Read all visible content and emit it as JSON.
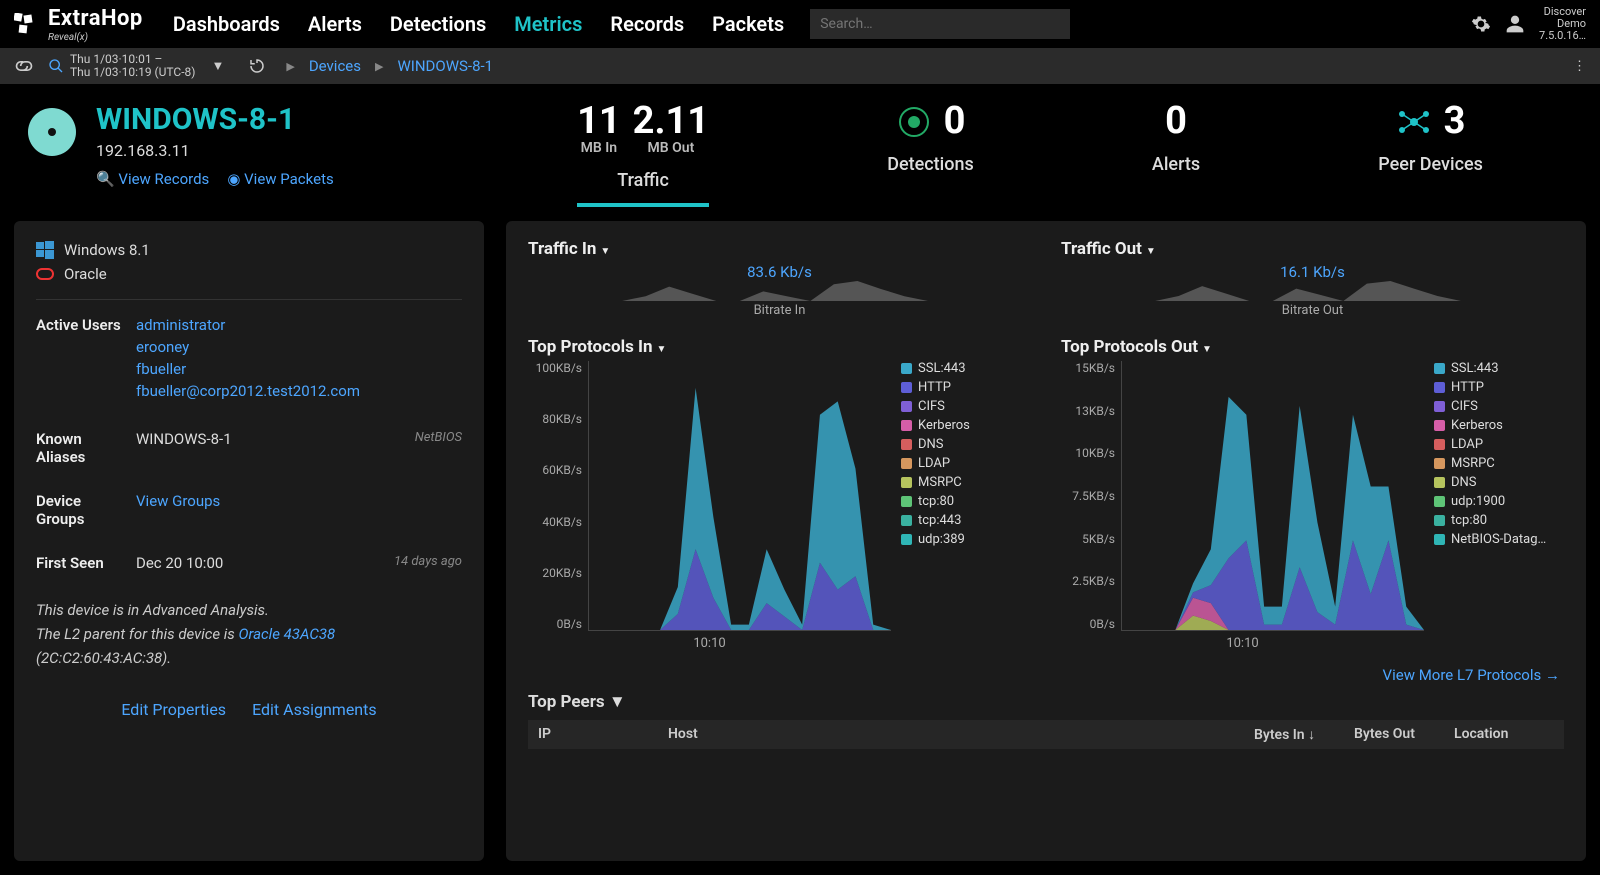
{
  "brand": {
    "name": "ExtraHop",
    "sub": "Reveal(x)"
  },
  "nav": {
    "items": [
      "Dashboards",
      "Alerts",
      "Detections",
      "Metrics",
      "Records",
      "Packets"
    ],
    "active_index": 3,
    "search_placeholder": "Search…"
  },
  "nav_right": {
    "line1": "Discover",
    "line2": "Demo",
    "line3": "7.5.0.16…"
  },
  "subbar": {
    "range_line1": "Thu 1/03·10:01 –",
    "range_line2": "Thu 1/03·10:19 (UTC-8)",
    "crumb1": "Devices",
    "crumb2": "WINDOWS-8-1"
  },
  "device": {
    "name": "WINDOWS-8-1",
    "ip": "192.168.3.11",
    "view_records": "View Records",
    "view_packets": "View Packets"
  },
  "stats": {
    "traffic": {
      "in_val": "11",
      "in_unit": "MB In",
      "out_val": "2.11",
      "out_unit": "MB Out",
      "label": "Traffic"
    },
    "detections": {
      "val": "0",
      "label": "Detections"
    },
    "alerts": {
      "val": "0",
      "label": "Alerts"
    },
    "peers": {
      "val": "3",
      "label": "Peer Devices"
    }
  },
  "sidebar": {
    "os1": "Windows 8.1",
    "os2": "Oracle",
    "active_users_label": "Active Users",
    "active_users": [
      "administrator",
      "erooney",
      "fbueller",
      "fbueller@corp2012.test2012.com"
    ],
    "aliases_label": "Known Aliases",
    "alias_val": "WINDOWS-8-1",
    "alias_type": "NetBIOS",
    "groups_label": "Device Groups",
    "groups_link": "View Groups",
    "first_seen_label": "First Seen",
    "first_seen_val": "Dec 20 10:00",
    "first_seen_ago": "14 days ago",
    "note1": "This device is in Advanced Analysis.",
    "note2a": "The L2 parent for this device is ",
    "note2b": "Oracle 43AC38",
    "note3": "(2C:C2:60:43:AC:38).",
    "edit_props": "Edit Properties",
    "edit_assign": "Edit Assignments"
  },
  "traffic_in": {
    "title": "Traffic In",
    "rate": "83.6 Kb/s",
    "sublabel": "Bitrate In"
  },
  "traffic_out": {
    "title": "Traffic Out",
    "rate": "16.1 Kb/s",
    "sublabel": "Bitrate Out"
  },
  "proto_in": {
    "title": "Top Protocols In",
    "xlabel": "10:10"
  },
  "proto_out": {
    "title": "Top Protocols Out",
    "xlabel": "10:10"
  },
  "legend_in": [
    {
      "name": "SSL:443",
      "color": "#3aa8c9"
    },
    {
      "name": "HTTP",
      "color": "#5e5ed6"
    },
    {
      "name": "CIFS",
      "color": "#7f5fd6"
    },
    {
      "name": "Kerberos",
      "color": "#d65ea8"
    },
    {
      "name": "DNS",
      "color": "#d65e5e"
    },
    {
      "name": "LDAP",
      "color": "#d6975e"
    },
    {
      "name": "MSRPC",
      "color": "#b6c45e"
    },
    {
      "name": "tcp:80",
      "color": "#5ec477"
    },
    {
      "name": "tcp:443",
      "color": "#3ab1a0"
    },
    {
      "name": "udp:389",
      "color": "#2fb5b5"
    }
  ],
  "legend_out": [
    {
      "name": "SSL:443",
      "color": "#3aa8c9"
    },
    {
      "name": "HTTP",
      "color": "#5e5ed6"
    },
    {
      "name": "CIFS",
      "color": "#7f5fd6"
    },
    {
      "name": "Kerberos",
      "color": "#d65ea8"
    },
    {
      "name": "LDAP",
      "color": "#d65e5e"
    },
    {
      "name": "MSRPC",
      "color": "#d6975e"
    },
    {
      "name": "DNS",
      "color": "#b6c45e"
    },
    {
      "name": "udp:1900",
      "color": "#5ec477"
    },
    {
      "name": "tcp:80",
      "color": "#3ab1a0"
    },
    {
      "name": "NetBIOS-Datag…",
      "color": "#2fb5b5"
    }
  ],
  "view_more": "View More L7 Protocols",
  "peers": {
    "title": "Top Peers",
    "cols": [
      "IP",
      "Host",
      "Bytes In ↓",
      "Bytes Out",
      "Location"
    ]
  },
  "chart_data": [
    {
      "type": "area",
      "title": "Bitrate In sparkline",
      "x": [
        0,
        1,
        2,
        3,
        4,
        5,
        6,
        7,
        8,
        9,
        10,
        11,
        12,
        13,
        14,
        15,
        16,
        17
      ],
      "values": [
        0,
        0,
        0,
        0,
        0,
        20,
        60,
        30,
        0,
        0,
        40,
        20,
        0,
        70,
        83.6,
        50,
        20,
        0
      ]
    },
    {
      "type": "area",
      "title": "Bitrate Out sparkline",
      "x": [
        0,
        1,
        2,
        3,
        4,
        5,
        6,
        7,
        8,
        9,
        10,
        11,
        12,
        13,
        14,
        15,
        16,
        17
      ],
      "values": [
        0,
        0,
        0,
        0,
        0,
        4,
        12,
        6,
        0,
        0,
        10,
        5,
        0,
        14,
        16.1,
        10,
        4,
        0
      ]
    },
    {
      "type": "area",
      "title": "Top Protocols In",
      "xlabel": "10:10",
      "ylabel": "KB/s",
      "ylim": [
        0,
        100
      ],
      "y_ticks": [
        "100KB/s",
        "80KB/s",
        "60KB/s",
        "40KB/s",
        "20KB/s",
        "0B/s"
      ],
      "x": [
        0,
        1,
        2,
        3,
        4,
        5,
        6,
        7,
        8,
        9,
        10,
        11,
        12,
        13,
        14,
        15,
        16,
        17
      ],
      "series": [
        {
          "name": "SSL:443",
          "color": "#3aa8c9",
          "values": [
            0,
            0,
            0,
            0,
            0,
            10,
            60,
            30,
            2,
            2,
            20,
            10,
            2,
            55,
            70,
            40,
            2,
            0
          ]
        },
        {
          "name": "HTTP",
          "color": "#5e5ed6",
          "values": [
            0,
            0,
            0,
            0,
            0,
            6,
            30,
            12,
            0,
            0,
            10,
            5,
            0,
            25,
            15,
            20,
            0,
            0
          ]
        }
      ]
    },
    {
      "type": "area",
      "title": "Top Protocols Out",
      "xlabel": "10:10",
      "ylabel": "KB/s",
      "ylim": [
        0,
        15
      ],
      "y_ticks": [
        "15KB/s",
        "13KB/s",
        "10KB/s",
        "7.5KB/s",
        "5KB/s",
        "2.5KB/s",
        "0B/s"
      ],
      "x": [
        0,
        1,
        2,
        3,
        4,
        5,
        6,
        7,
        8,
        9,
        10,
        11,
        12,
        13,
        14,
        15,
        16,
        17
      ],
      "series": [
        {
          "name": "SSL:443",
          "color": "#3aa8c9",
          "values": [
            0,
            0,
            0,
            0,
            0.5,
            2,
            9,
            7,
            1,
            1,
            9,
            5,
            1,
            7,
            6,
            3,
            1,
            0
          ]
        },
        {
          "name": "HTTP",
          "color": "#5e5ed6",
          "values": [
            0,
            0,
            0,
            0,
            0.3,
            1,
            4,
            5,
            0.3,
            0.3,
            3.5,
            1,
            0.3,
            5,
            2,
            5,
            0.3,
            0
          ]
        },
        {
          "name": "Kerberos",
          "color": "#d65ea8",
          "values": [
            0,
            0,
            0,
            0,
            1,
            1,
            0,
            0,
            0,
            0,
            0,
            0,
            0,
            0,
            0,
            0,
            0,
            0
          ]
        },
        {
          "name": "DNS",
          "color": "#b6c45e",
          "values": [
            0,
            0,
            0,
            0,
            0.8,
            0.5,
            0,
            0,
            0,
            0,
            0,
            0,
            0,
            0,
            0,
            0,
            0,
            0
          ]
        }
      ]
    }
  ]
}
